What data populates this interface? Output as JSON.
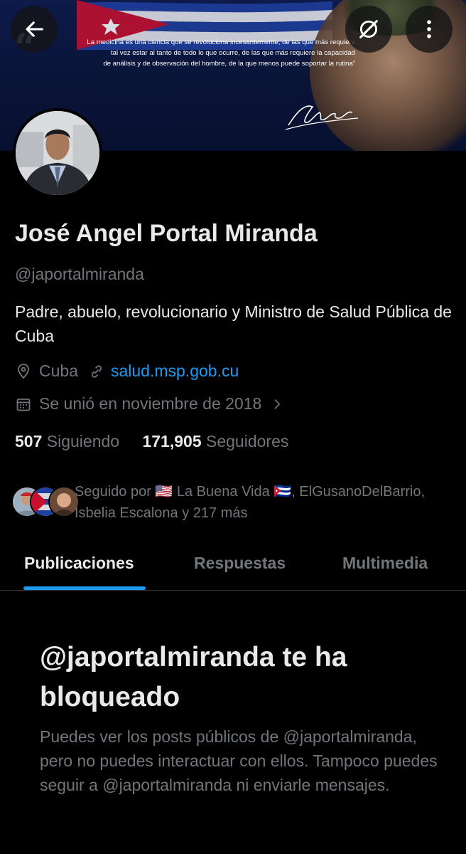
{
  "banner": {
    "quote": "La medicina es una ciencia que se revoluciona incesantemente, de las que más requiere tal vez estar al tanto de todo lo que ocurre, de las que más requiere la capacidad de análisis y de observación del hombre, de la que menos puede soportar la rutina”",
    "quote_lines": [
      "La medicina es una ciencia que se revoluciona incesantemente, de las que más requiere",
      "tal vez estar al tanto de todo lo que ocurre, de las que más requiere la capacidad",
      "de análisis y de observación del hombre, de la que menos puede soportar la rutina”"
    ]
  },
  "top_bar": {
    "back_icon": "arrow-left-icon",
    "grok_icon": "grok-icon",
    "more_icon": "more-vertical-icon"
  },
  "profile": {
    "display_name": "José Angel Portal Miranda",
    "handle": "@japortalmiranda",
    "bio": "Padre, abuelo, revolucionario y Ministro de Salud Pública de Cuba",
    "location": "Cuba",
    "website": "salud.msp.gob.cu",
    "joined": "Se unió en noviembre de 2018",
    "following_count": "507",
    "following_label": "Siguiendo",
    "followers_count": "171,905",
    "followers_label": "Seguidores"
  },
  "followed_by": {
    "text": "Seguido por 🇺🇸 La Buena Vida 🇨🇺, ElGusanoDelBarrio, Isbelia Escalona y 217 más"
  },
  "tabs": [
    {
      "label": "Publicaciones",
      "active": true
    },
    {
      "label": "Respuestas",
      "active": false
    },
    {
      "label": "Multimedia",
      "active": false
    }
  ],
  "blocked": {
    "title": "@japortalmiranda te ha bloqueado",
    "body": "Puedes ver los posts públicos de @japortalmiranda, pero no puedes interactuar con ellos. Tampoco puedes seguir a @japortalmiranda ni enviarle mensajes."
  },
  "colors": {
    "background": "#000000",
    "text_primary": "#e7e9ea",
    "text_secondary": "#71767b",
    "accent": "#1d9bf0"
  }
}
